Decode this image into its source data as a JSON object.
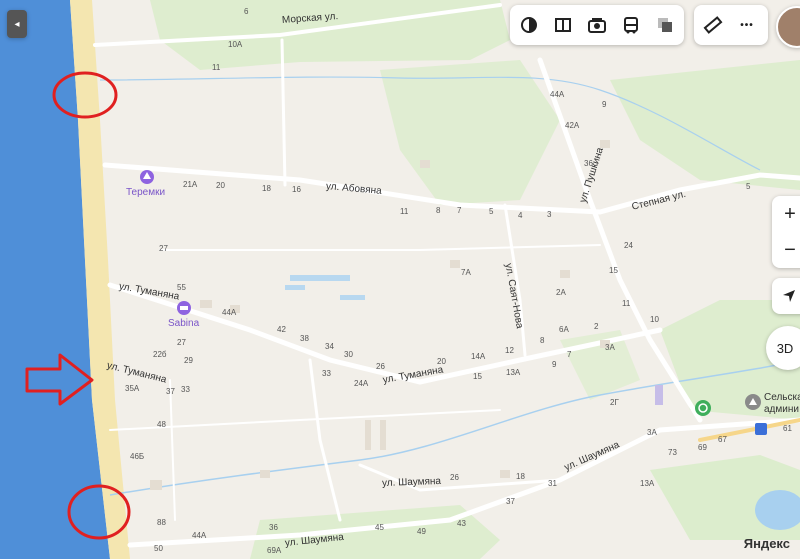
{
  "streets": {
    "morskaya": "Морская ул.",
    "abovyana": "ул. Абовяна",
    "tumanyana_top": "ул. Туманяна",
    "tumanyana_left": "ул. Туманяна",
    "tumanyana_mid": "ул. Туманяна",
    "sayat_nova": "ул. Саят-Нова",
    "pushkina": "ул. Пушкина",
    "stepnaya": "Степная ул.",
    "shaumyana_1": "ул. Шаумяна",
    "shaumyana_2": "ул. Шаумяна",
    "shaumyana_3": "ул. Шаумяна"
  },
  "pois": {
    "teremki": "Теремки",
    "sabina": "Sabina",
    "selskaya": "Сельская",
    "admin": "админи"
  },
  "house_numbers": {
    "n10A": "10А",
    "n11": "11",
    "n6": "6",
    "n44A": "44А",
    "n42A": "42А",
    "n9": "9",
    "n36": "36",
    "n21A": "21А",
    "n20a": "20",
    "n18": "18",
    "n16": "16",
    "n11b": "11",
    "n8": "8",
    "n7": "7",
    "n5": "5",
    "n4": "4",
    "n3": "3",
    "n5b": "5",
    "n24": "24",
    "n15": "15",
    "n27": "27",
    "n7A": "7А",
    "n2A": "2А",
    "n11c": "11",
    "n10": "10",
    "n55": "55",
    "n44Ab": "44А",
    "n42": "42",
    "n38": "38",
    "n34": "34",
    "n30": "30",
    "n26": "26",
    "n20b": "20",
    "n14A": "14А",
    "n12": "12",
    "n8b": "8",
    "n7b": "7",
    "n3A": "3А",
    "n6A": "6А",
    "n2": "2",
    "n22b": "22б",
    "n27b": "27",
    "n29": "29",
    "n35A": "35А",
    "n37": "37",
    "n33": "33",
    "n33b": "33",
    "n24A": "24А",
    "n15b": "15",
    "n13A": "13А",
    "n9b": "9",
    "n48": "48",
    "n2G": "2Г",
    "n46B": "46Б",
    "n3Ab": "3А",
    "n73": "73",
    "n69": "69",
    "n67": "67",
    "n61": "61",
    "n26b": "26",
    "n18b": "18",
    "n31": "31",
    "n37b": "37",
    "n13Ab": "13А",
    "n88": "88",
    "n44Ac": "44А",
    "n36b": "36",
    "n45": "45",
    "n43": "43",
    "n49": "49",
    "n50": "50",
    "n69A": "69А"
  },
  "controls": {
    "zoom_in": "+",
    "zoom_out": "−",
    "three_d": "3D",
    "more": "•••",
    "collapse": "◂"
  },
  "watermark": "Яндекс",
  "colors": {
    "sea": "#4f8fd8",
    "beach": "#f4e6b0",
    "land": "#f2efe9",
    "green": "#d6ecc6",
    "road": "#ffffff",
    "water_line": "#a8d0ef",
    "annotation_red": "#e02020",
    "poi_purple": "#8e63e0"
  }
}
